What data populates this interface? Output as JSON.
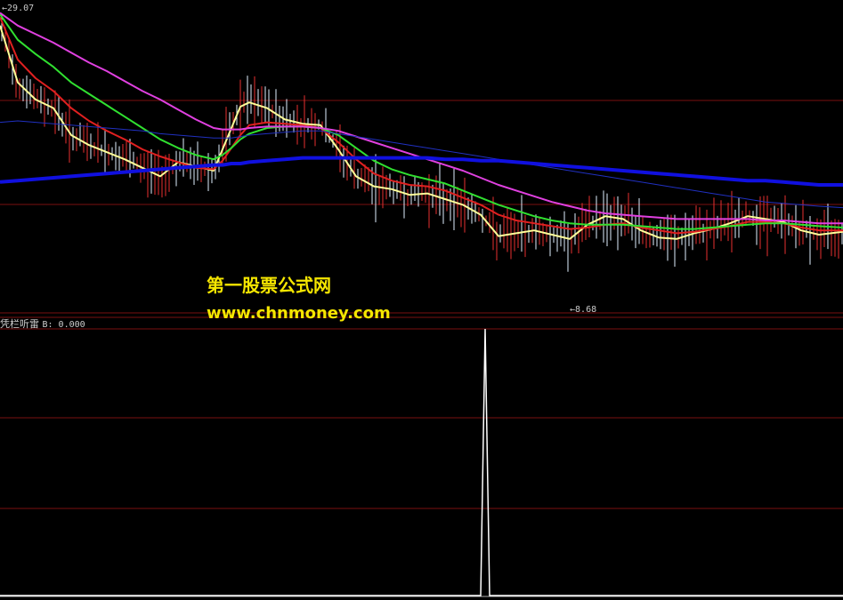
{
  "main_chart": {
    "max_label": "29.07",
    "min_label": "8.68"
  },
  "indicator": {
    "name": "凭栏听雷",
    "value_text": "B: 0.000"
  },
  "watermark": {
    "line1": "第一股票公式网",
    "line2": "www.chnmoney.com"
  },
  "colors": {
    "background": "#000000",
    "grid": "#7a1010",
    "candle_up": "#e83030",
    "candle_down": "#e0f0ff",
    "ma_yellow": "#ffff99",
    "ma_red": "#e02020",
    "ma_green": "#30e030",
    "ma_magenta": "#e040e0",
    "ma_blue_thin": "#2030c0",
    "ma_blue_thick": "#1010e0",
    "signal": "#ffffff",
    "watermark": "#f5e600"
  },
  "chart_data": [
    {
      "type": "line",
      "title": "",
      "ylim": [
        8.0,
        29.5
      ],
      "x": [
        0,
        20,
        40,
        60,
        80,
        100,
        120,
        140,
        160,
        180,
        200,
        220,
        240,
        250,
        260,
        270,
        280,
        300,
        320,
        340,
        360,
        380,
        400,
        420,
        440,
        460,
        480,
        500,
        520,
        540,
        560,
        580,
        600,
        620,
        640,
        660,
        680,
        700,
        720,
        740,
        760,
        780,
        800,
        820,
        840,
        860,
        880,
        900,
        920,
        947
      ],
      "series": [
        {
          "name": "",
          "color_key": "ma_yellow",
          "values": [
            28.2,
            24.2,
            23.0,
            22.4,
            20.5,
            19.8,
            19.3,
            18.8,
            18.2,
            17.6,
            18.6,
            18.3,
            18.0,
            19.5,
            21.0,
            22.5,
            22.8,
            22.4,
            21.6,
            21.3,
            21.2,
            19.5,
            17.6,
            16.9,
            16.7,
            16.3,
            16.4,
            16.0,
            15.6,
            14.9,
            13.4,
            13.6,
            13.8,
            13.5,
            13.2,
            14.2,
            14.8,
            14.6,
            13.8,
            13.3,
            13.2,
            13.6,
            13.9,
            14.3,
            14.8,
            14.6,
            14.4,
            13.8,
            13.5,
            13.7
          ]
        },
        {
          "name": "",
          "color_key": "ma_red",
          "values": [
            28.8,
            25.8,
            24.5,
            23.6,
            22.4,
            21.5,
            20.8,
            20.2,
            19.5,
            19.0,
            18.6,
            18.2,
            18.1,
            18.7,
            19.6,
            20.5,
            21.2,
            21.4,
            21.3,
            21.2,
            21.0,
            20.0,
            18.8,
            17.8,
            17.3,
            17.0,
            16.9,
            16.6,
            16.1,
            15.6,
            14.9,
            14.5,
            14.3,
            14.1,
            13.9,
            14.0,
            14.2,
            14.3,
            14.0,
            13.8,
            13.6,
            13.7,
            13.9,
            14.1,
            14.4,
            14.4,
            14.3,
            14.0,
            13.8,
            13.8
          ]
        },
        {
          "name": "",
          "color_key": "ma_green",
          "values": [
            29.0,
            27.2,
            26.2,
            25.3,
            24.2,
            23.4,
            22.6,
            21.8,
            21.0,
            20.2,
            19.6,
            19.1,
            18.8,
            19.1,
            19.6,
            20.2,
            20.6,
            21.0,
            21.1,
            21.1,
            21.0,
            20.5,
            19.6,
            18.7,
            18.1,
            17.7,
            17.4,
            17.1,
            16.6,
            16.1,
            15.6,
            15.2,
            14.8,
            14.5,
            14.3,
            14.2,
            14.2,
            14.2,
            14.1,
            14.0,
            13.9,
            13.9,
            14.0,
            14.1,
            14.2,
            14.3,
            14.3,
            14.2,
            14.1,
            14.0
          ]
        },
        {
          "name": "",
          "color_key": "ma_magenta",
          "values": [
            29.1,
            28.2,
            27.6,
            27.0,
            26.3,
            25.6,
            25.0,
            24.3,
            23.6,
            23.0,
            22.3,
            21.6,
            21.0,
            20.9,
            20.9,
            20.9,
            21.0,
            21.1,
            21.1,
            21.1,
            21.0,
            20.8,
            20.4,
            20.0,
            19.6,
            19.2,
            18.8,
            18.4,
            18.0,
            17.5,
            17.0,
            16.6,
            16.2,
            15.8,
            15.5,
            15.2,
            15.0,
            14.9,
            14.8,
            14.7,
            14.6,
            14.6,
            14.6,
            14.6,
            14.6,
            14.5,
            14.5,
            14.4,
            14.3,
            14.3
          ]
        },
        {
          "name": "",
          "color_key": "ma_blue_thin",
          "values": [
            21.4,
            21.5,
            21.4,
            21.3,
            21.2,
            21.1,
            21.0,
            20.9,
            20.8,
            20.6,
            20.5,
            20.4,
            20.3,
            20.3,
            20.3,
            20.4,
            20.5,
            20.6,
            20.7,
            20.8,
            20.8,
            20.6,
            20.4,
            20.2,
            20.0,
            19.8,
            19.6,
            19.4,
            19.2,
            19.0,
            18.8,
            18.6,
            18.4,
            18.2,
            18.0,
            17.8,
            17.6,
            17.4,
            17.2,
            17.0,
            16.8,
            16.6,
            16.4,
            16.2,
            16.0,
            15.8,
            15.7,
            15.6,
            15.5,
            15.4
          ]
        },
        {
          "name": "",
          "color_key": "ma_blue_thick",
          "values": [
            17.2,
            17.3,
            17.4,
            17.5,
            17.6,
            17.7,
            17.8,
            17.9,
            18.0,
            18.1,
            18.2,
            18.3,
            18.4,
            18.4,
            18.5,
            18.5,
            18.6,
            18.7,
            18.8,
            18.9,
            18.9,
            18.9,
            18.9,
            18.9,
            18.9,
            18.9,
            18.9,
            18.8,
            18.8,
            18.7,
            18.7,
            18.6,
            18.5,
            18.4,
            18.3,
            18.2,
            18.1,
            18.0,
            17.9,
            17.8,
            17.7,
            17.6,
            17.5,
            17.4,
            17.3,
            17.3,
            17.2,
            17.1,
            17.0,
            17.0
          ]
        }
      ]
    },
    {
      "type": "line",
      "title": "",
      "ylim": [
        0,
        1
      ],
      "x": [
        0,
        540,
        545,
        550,
        947
      ],
      "series": [
        {
          "name": "",
          "color_key": "signal",
          "values": [
            0,
            0,
            1,
            0,
            0
          ]
        }
      ]
    }
  ]
}
